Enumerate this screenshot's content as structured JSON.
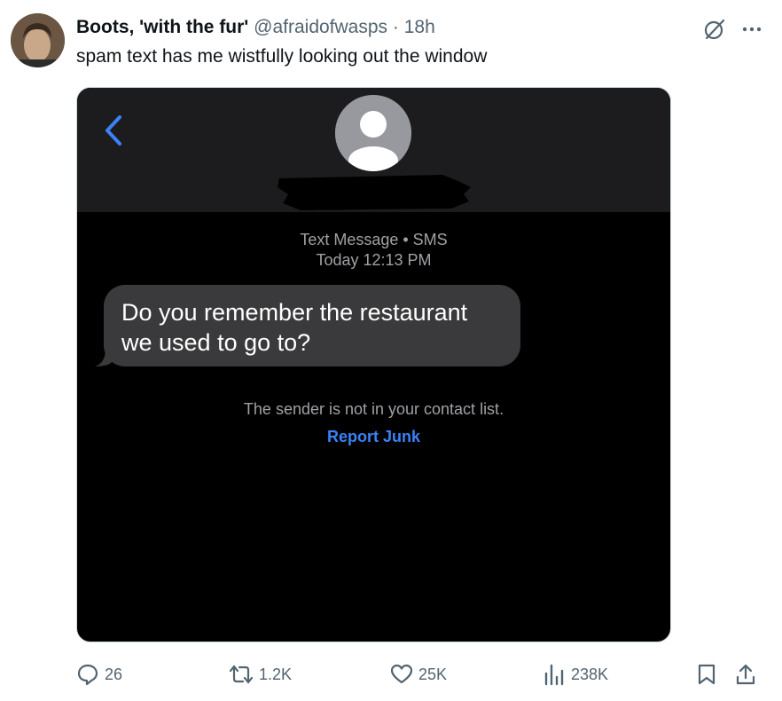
{
  "tweet": {
    "author_name": "Boots, 'with the fur'",
    "handle": "@afraidofwasps",
    "separator": "·",
    "time": "18h",
    "text": "spam text has me wistfully looking out the window"
  },
  "screenshot": {
    "message_type": "Text Message • SMS",
    "timestamp": "Today 12:13 PM",
    "message_line1": "Do you remember the restaurant",
    "message_line2": "we used to go to?",
    "sender_note": "The sender is not in your contact list.",
    "report_link": "Report Junk"
  },
  "actions": {
    "replies": "26",
    "reposts": "1.2K",
    "likes": "25K",
    "views": "238K"
  },
  "colors": {
    "link_blue": "#3a82f7",
    "bubble_gray": "#3a3a3c",
    "muted_text": "#536471"
  },
  "icons": [
    "grok-icon",
    "more-icon",
    "back-chevron-icon",
    "contact-avatar-icon",
    "reply-icon",
    "retweet-icon",
    "like-icon",
    "views-icon",
    "bookmark-icon",
    "share-icon"
  ]
}
